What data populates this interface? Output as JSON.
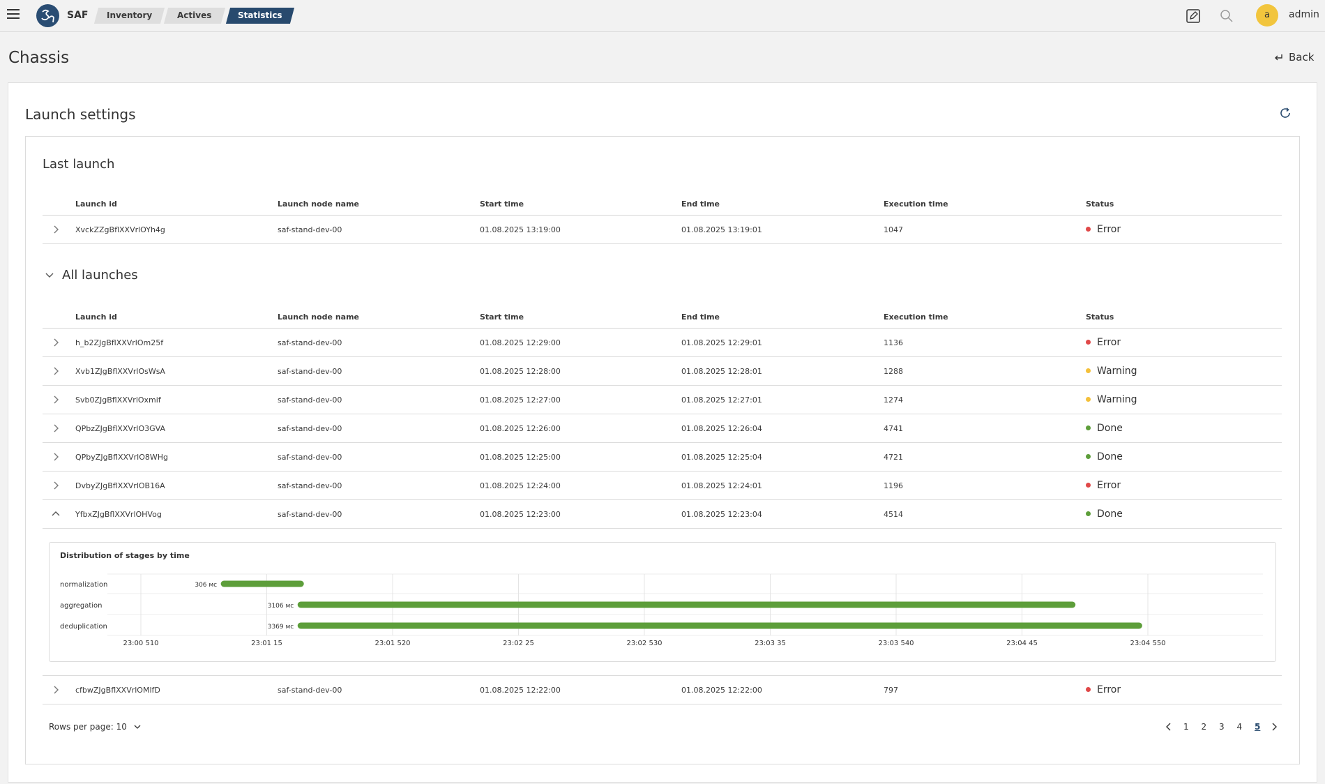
{
  "header": {
    "app_name": "SAF",
    "tabs": [
      {
        "label": "Inventory",
        "active": false
      },
      {
        "label": "Actives",
        "active": false
      },
      {
        "label": "Statistics",
        "active": true
      }
    ],
    "user": {
      "avatar_letter": "a",
      "name": "admin"
    },
    "icons": [
      "menu-icon",
      "edit-icon",
      "search-icon"
    ]
  },
  "page": {
    "title": "Chassis",
    "back_label": "Back"
  },
  "launch_settings": {
    "title": "Launch settings",
    "columns": [
      "Launch id",
      "Launch node name",
      "Start time",
      "End time",
      "Execution time",
      "Status"
    ],
    "last_launch": {
      "title": "Last launch",
      "rows": [
        {
          "id": "XvckZZgBflXXVrlOYh4g",
          "node": "saf-stand-dev-00",
          "start": "01.08.2025 13:19:00",
          "end": "01.08.2025 13:19:01",
          "exec": "1047",
          "status": "Error"
        }
      ]
    },
    "all_launches": {
      "title": "All launches",
      "rows": [
        {
          "id": "h_b2ZJgBflXXVrlOm25f",
          "node": "saf-stand-dev-00",
          "start": "01.08.2025 12:29:00",
          "end": "01.08.2025 12:29:01",
          "exec": "1136",
          "status": "Error"
        },
        {
          "id": "Xvb1ZJgBflXXVrlOsWsA",
          "node": "saf-stand-dev-00",
          "start": "01.08.2025 12:28:00",
          "end": "01.08.2025 12:28:01",
          "exec": "1288",
          "status": "Warning"
        },
        {
          "id": "Svb0ZJgBflXXVrlOxmif",
          "node": "saf-stand-dev-00",
          "start": "01.08.2025 12:27:00",
          "end": "01.08.2025 12:27:01",
          "exec": "1274",
          "status": "Warning"
        },
        {
          "id": "QPbzZJgBflXXVrlO3GVA",
          "node": "saf-stand-dev-00",
          "start": "01.08.2025 12:26:00",
          "end": "01.08.2025 12:26:04",
          "exec": "4741",
          "status": "Done"
        },
        {
          "id": "QPbyZJgBflXXVrlO8WHg",
          "node": "saf-stand-dev-00",
          "start": "01.08.2025 12:25:00",
          "end": "01.08.2025 12:25:04",
          "exec": "4721",
          "status": "Done"
        },
        {
          "id": "DvbyZJgBflXXVrlOB16A",
          "node": "saf-stand-dev-00",
          "start": "01.08.2025 12:24:00",
          "end": "01.08.2025 12:24:01",
          "exec": "1196",
          "status": "Error"
        },
        {
          "id": "YfbxZJgBflXXVrlOHVog",
          "node": "saf-stand-dev-00",
          "start": "01.08.2025 12:23:00",
          "end": "01.08.2025 12:23:04",
          "exec": "4514",
          "status": "Done",
          "expanded": true
        }
      ],
      "after_rows": [
        {
          "id": "cfbwZJgBflXXVrlOMlfD",
          "node": "saf-stand-dev-00",
          "start": "01.08.2025 12:22:00",
          "end": "01.08.2025 12:22:00",
          "exec": "797",
          "status": "Error"
        }
      ]
    },
    "status_colors": {
      "Error": "#e04848",
      "Warning": "#f4c03a",
      "Done": "#5d9e3a"
    },
    "pagination": {
      "rows_per_page_label": "Rows per page: 10",
      "pages": [
        "1",
        "2",
        "3",
        "4",
        "5"
      ],
      "current_page": "5"
    }
  },
  "chart_data": {
    "type": "gantt",
    "title": "Distribution of stages by time",
    "x_ticks": [
      "23:00 510",
      "23:01 15",
      "23:01 520",
      "23:02 25",
      "23:02 530",
      "23:03 35",
      "23:03 540",
      "23:04 45",
      "23:04 550"
    ],
    "bar_color": "#5d9e3a",
    "series": [
      {
        "name": "normalization",
        "duration_label": "306 мс",
        "start_tick": 0.66,
        "end_tick": 1.27
      },
      {
        "name": "aggregation",
        "duration_label": "3106 мс",
        "start_tick": 1.27,
        "end_tick": 7.4
      },
      {
        "name": "deduplication",
        "duration_label": "3369 мс",
        "start_tick": 1.27,
        "end_tick": 7.93
      }
    ]
  }
}
